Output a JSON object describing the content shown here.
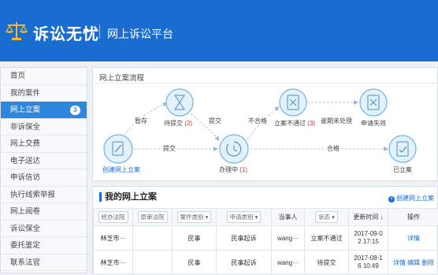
{
  "header": {
    "brand": "诉讼无忧",
    "subtitle": "网上诉讼平台"
  },
  "sidebar": {
    "items": [
      {
        "label": "首页"
      },
      {
        "label": "我的案件"
      },
      {
        "label": "网上立案",
        "badge": "3",
        "active": true
      },
      {
        "label": "非诉保全"
      },
      {
        "label": "网上交费"
      },
      {
        "label": "电子送达"
      },
      {
        "label": "申诉信访"
      },
      {
        "label": "执行线索举报"
      },
      {
        "label": "网上阅卷"
      },
      {
        "label": "诉讼保全"
      },
      {
        "label": "委托鉴定"
      },
      {
        "label": "联系法官"
      }
    ]
  },
  "flow": {
    "title": "网上立案流程",
    "nodes": {
      "create": {
        "label": "创建网上立案"
      },
      "pending": {
        "label": "待提交",
        "count": "(2)"
      },
      "processing": {
        "label": "办理中",
        "count": "(1)"
      },
      "rejected": {
        "label": "立案不通过",
        "count": "(3)"
      },
      "failed": {
        "label": "申请失效"
      },
      "filed": {
        "label": "已立案"
      }
    },
    "edges": {
      "save": "暂存",
      "submit1": "提交",
      "submit2": "提交",
      "unqualified": "不合格",
      "overdue": "逾期未处理",
      "qualified": "合格"
    }
  },
  "cases": {
    "title": "我的网上立案",
    "create_label": "创建网上立案",
    "filters": {
      "court": "经办法院",
      "trial_court": "原审法院",
      "case_type": "案件类别",
      "apply_type": "申请类别",
      "party": "当事人",
      "status": "状态",
      "updated": "更新时间 ↓",
      "actions": "操作"
    },
    "rows": [
      {
        "court": "林芝市···",
        "trial_court": "",
        "case_type": "民事",
        "apply_type": "民事起诉",
        "party": "wang···",
        "status": "立案不通过",
        "date": "2017-09-0",
        "time": "2 17:15",
        "actions": [
          "详情"
        ]
      },
      {
        "court": "林芝市···",
        "trial_court": "",
        "case_type": "民事",
        "apply_type": "民事起诉",
        "party": "wang···",
        "status": "待提交",
        "date": "2017-08-1",
        "time": "6 10:49",
        "actions": [
          "详情",
          "编辑",
          "删除"
        ]
      }
    ]
  },
  "colors": {
    "brand_blue": "#1a6dd0",
    "sidebar_active": "#2f86de",
    "count_red": "#d9302d",
    "flow_circle_fill": "#e3f1fb",
    "flow_stroke": "#6fb3e6"
  },
  "icons": {
    "logo": "scales-of-justice-icon",
    "create": "pencil-document-icon",
    "pending": "hourglass-icon",
    "processing": "clock-refresh-icon",
    "rejected": "x-document-icon",
    "failed": "x-document-icon",
    "filed": "check-document-icon",
    "create_link": "plus-circle-icon",
    "sort": "arrow-down-icon"
  }
}
